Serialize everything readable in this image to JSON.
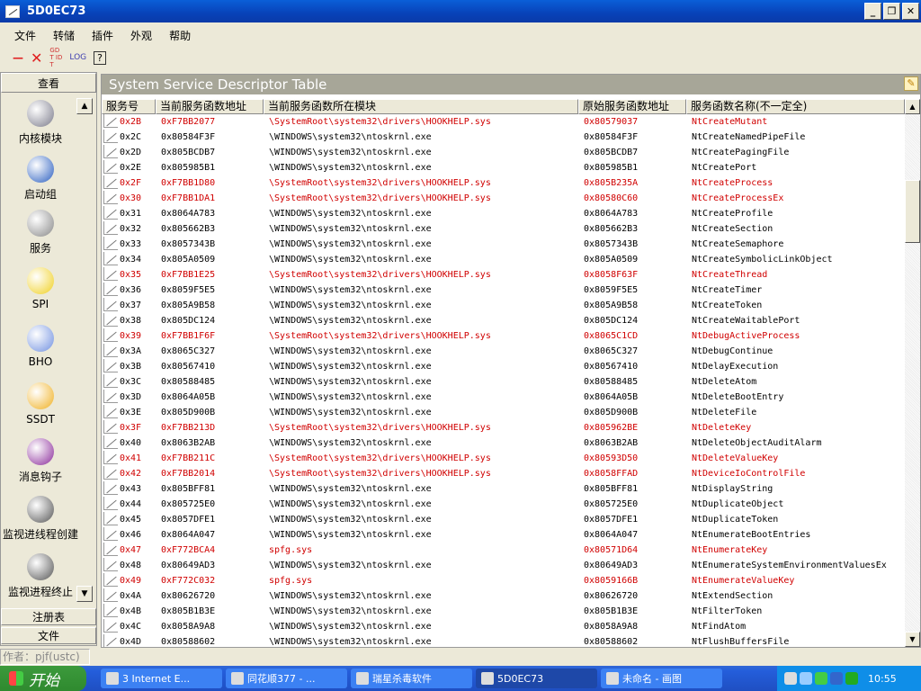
{
  "window": {
    "title": "5D0EC73"
  },
  "menu": [
    "文件",
    "转储",
    "插件",
    "外观",
    "帮助"
  ],
  "toolbar": {
    "minus": "—",
    "close": "✕",
    "gdt": "GDT IDT",
    "log": "LOG",
    "help": "?"
  },
  "sidebar": {
    "header": "查看",
    "items": [
      {
        "label": "内核模块",
        "icon": "disk-drive-icon",
        "color": "#7a7a8a"
      },
      {
        "label": "启动组",
        "icon": "globe-icon",
        "color": "#2a5ec0"
      },
      {
        "label": "服务",
        "icon": "computer-icon",
        "color": "#888"
      },
      {
        "label": "SPI",
        "icon": "warning-icon",
        "color": "#f0d020"
      },
      {
        "label": "BHO",
        "icon": "ie-page-icon",
        "color": "#7090e0"
      },
      {
        "label": "SSDT",
        "icon": "bell-icon",
        "color": "#f0b020"
      },
      {
        "label": "消息钩子",
        "icon": "number-5-icon",
        "color": "#8a2a9a"
      },
      {
        "label": "监视进线程创建",
        "icon": "monitor-orb-icon",
        "color": "#555"
      },
      {
        "label": "监视进程终止",
        "icon": "monitor-orb-icon",
        "color": "#555"
      }
    ],
    "bottom": [
      "注册表",
      "文件"
    ]
  },
  "panel": {
    "title": "System Service Descriptor Table",
    "columns": [
      "服务号",
      "当前服务函数地址",
      "当前服务函数所在模块",
      "原始服务函数地址",
      "服务函数名称(不一定全)"
    ],
    "hook_color": "#d00000",
    "rows": [
      [
        "0x2B",
        "0xF7BB2077",
        "\\SystemRoot\\system32\\drivers\\HOOKHELP.sys",
        "0x80579037",
        "NtCreateMutant",
        true
      ],
      [
        "0x2C",
        "0x80584F3F",
        "\\WINDOWS\\system32\\ntoskrnl.exe",
        "0x80584F3F",
        "NtCreateNamedPipeFile",
        false
      ],
      [
        "0x2D",
        "0x805BCDB7",
        "\\WINDOWS\\system32\\ntoskrnl.exe",
        "0x805BCDB7",
        "NtCreatePagingFile",
        false
      ],
      [
        "0x2E",
        "0x805985B1",
        "\\WINDOWS\\system32\\ntoskrnl.exe",
        "0x805985B1",
        "NtCreatePort",
        false
      ],
      [
        "0x2F",
        "0xF7BB1D80",
        "\\SystemRoot\\system32\\drivers\\HOOKHELP.sys",
        "0x805B235A",
        "NtCreateProcess",
        true
      ],
      [
        "0x30",
        "0xF7BB1DA1",
        "\\SystemRoot\\system32\\drivers\\HOOKHELP.sys",
        "0x80580C60",
        "NtCreateProcessEx",
        true
      ],
      [
        "0x31",
        "0x8064A783",
        "\\WINDOWS\\system32\\ntoskrnl.exe",
        "0x8064A783",
        "NtCreateProfile",
        false
      ],
      [
        "0x32",
        "0x805662B3",
        "\\WINDOWS\\system32\\ntoskrnl.exe",
        "0x805662B3",
        "NtCreateSection",
        false
      ],
      [
        "0x33",
        "0x8057343B",
        "\\WINDOWS\\system32\\ntoskrnl.exe",
        "0x8057343B",
        "NtCreateSemaphore",
        false
      ],
      [
        "0x34",
        "0x805A0509",
        "\\WINDOWS\\system32\\ntoskrnl.exe",
        "0x805A0509",
        "NtCreateSymbolicLinkObject",
        false
      ],
      [
        "0x35",
        "0xF7BB1E25",
        "\\SystemRoot\\system32\\drivers\\HOOKHELP.sys",
        "0x8058F63F",
        "NtCreateThread",
        true
      ],
      [
        "0x36",
        "0x8059F5E5",
        "\\WINDOWS\\system32\\ntoskrnl.exe",
        "0x8059F5E5",
        "NtCreateTimer",
        false
      ],
      [
        "0x37",
        "0x805A9B58",
        "\\WINDOWS\\system32\\ntoskrnl.exe",
        "0x805A9B58",
        "NtCreateToken",
        false
      ],
      [
        "0x38",
        "0x805DC124",
        "\\WINDOWS\\system32\\ntoskrnl.exe",
        "0x805DC124",
        "NtCreateWaitablePort",
        false
      ],
      [
        "0x39",
        "0xF7BB1F6F",
        "\\SystemRoot\\system32\\drivers\\HOOKHELP.sys",
        "0x8065C1CD",
        "NtDebugActiveProcess",
        true
      ],
      [
        "0x3A",
        "0x8065C327",
        "\\WINDOWS\\system32\\ntoskrnl.exe",
        "0x8065C327",
        "NtDebugContinue",
        false
      ],
      [
        "0x3B",
        "0x80567410",
        "\\WINDOWS\\system32\\ntoskrnl.exe",
        "0x80567410",
        "NtDelayExecution",
        false
      ],
      [
        "0x3C",
        "0x80588485",
        "\\WINDOWS\\system32\\ntoskrnl.exe",
        "0x80588485",
        "NtDeleteAtom",
        false
      ],
      [
        "0x3D",
        "0x8064A05B",
        "\\WINDOWS\\system32\\ntoskrnl.exe",
        "0x8064A05B",
        "NtDeleteBootEntry",
        false
      ],
      [
        "0x3E",
        "0x805D900B",
        "\\WINDOWS\\system32\\ntoskrnl.exe",
        "0x805D900B",
        "NtDeleteFile",
        false
      ],
      [
        "0x3F",
        "0xF7BB213D",
        "\\SystemRoot\\system32\\drivers\\HOOKHELP.sys",
        "0x805962BE",
        "NtDeleteKey",
        true
      ],
      [
        "0x40",
        "0x8063B2AB",
        "\\WINDOWS\\system32\\ntoskrnl.exe",
        "0x8063B2AB",
        "NtDeleteObjectAuditAlarm",
        false
      ],
      [
        "0x41",
        "0xF7BB211C",
        "\\SystemRoot\\system32\\drivers\\HOOKHELP.sys",
        "0x80593D50",
        "NtDeleteValueKey",
        true
      ],
      [
        "0x42",
        "0xF7BB2014",
        "\\SystemRoot\\system32\\drivers\\HOOKHELP.sys",
        "0x8058FFAD",
        "NtDeviceIoControlFile",
        true
      ],
      [
        "0x43",
        "0x805BFF81",
        "\\WINDOWS\\system32\\ntoskrnl.exe",
        "0x805BFF81",
        "NtDisplayString",
        false
      ],
      [
        "0x44",
        "0x805725E0",
        "\\WINDOWS\\system32\\ntoskrnl.exe",
        "0x805725E0",
        "NtDuplicateObject",
        false
      ],
      [
        "0x45",
        "0x8057DFE1",
        "\\WINDOWS\\system32\\ntoskrnl.exe",
        "0x8057DFE1",
        "NtDuplicateToken",
        false
      ],
      [
        "0x46",
        "0x8064A047",
        "\\WINDOWS\\system32\\ntoskrnl.exe",
        "0x8064A047",
        "NtEnumerateBootEntries",
        false
      ],
      [
        "0x47",
        "0xF772BCA4",
        "spfg.sys",
        "0x80571D64",
        "NtEnumerateKey",
        true
      ],
      [
        "0x48",
        "0x80649AD3",
        "\\WINDOWS\\system32\\ntoskrnl.exe",
        "0x80649AD3",
        "NtEnumerateSystemEnvironmentValuesEx",
        false
      ],
      [
        "0x49",
        "0xF772C032",
        "spfg.sys",
        "0x8059166B",
        "NtEnumerateValueKey",
        true
      ],
      [
        "0x4A",
        "0x80626720",
        "\\WINDOWS\\system32\\ntoskrnl.exe",
        "0x80626720",
        "NtExtendSection",
        false
      ],
      [
        "0x4B",
        "0x805B1B3E",
        "\\WINDOWS\\system32\\ntoskrnl.exe",
        "0x805B1B3E",
        "NtFilterToken",
        false
      ],
      [
        "0x4C",
        "0x8058A9A8",
        "\\WINDOWS\\system32\\ntoskrnl.exe",
        "0x8058A9A8",
        "NtFindAtom",
        false
      ],
      [
        "0x4D",
        "0x80588602",
        "\\WINDOWS\\system32\\ntoskrnl.exe",
        "0x80588602",
        "NtFlushBuffersFile",
        false
      ]
    ]
  },
  "status": "作者：pjf(ustc)",
  "taskbar": {
    "start": "开始",
    "tasks": [
      {
        "label": "3 Internet E...",
        "active": false
      },
      {
        "label": "同花顺377 - ...",
        "active": false
      },
      {
        "label": "瑞星杀毒软件",
        "active": false
      },
      {
        "label": "5D0EC73",
        "active": true
      },
      {
        "label": "未命名 - 画图",
        "active": false
      }
    ],
    "clock": "10:55"
  }
}
